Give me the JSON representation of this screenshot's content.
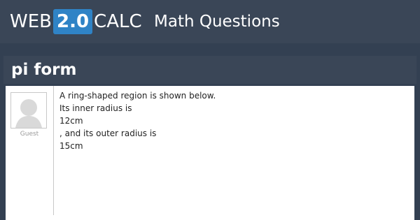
{
  "header": {
    "logo": {
      "prefix": "WEB",
      "version": "2.0",
      "suffix": "CALC"
    },
    "section": "Math Questions"
  },
  "question": {
    "title": "pi form",
    "author": "Guest",
    "lines": [
      "A ring-shaped region is shown below.",
      "Its inner radius is",
      "12cm",
      ", and its outer radius is",
      "15cm"
    ]
  },
  "colors": {
    "background": "#334052",
    "header": "#3a4657",
    "logo_badge": "#2f83c6",
    "panel": "#ffffff"
  },
  "icons": {
    "avatar": "default-user-avatar-icon"
  }
}
